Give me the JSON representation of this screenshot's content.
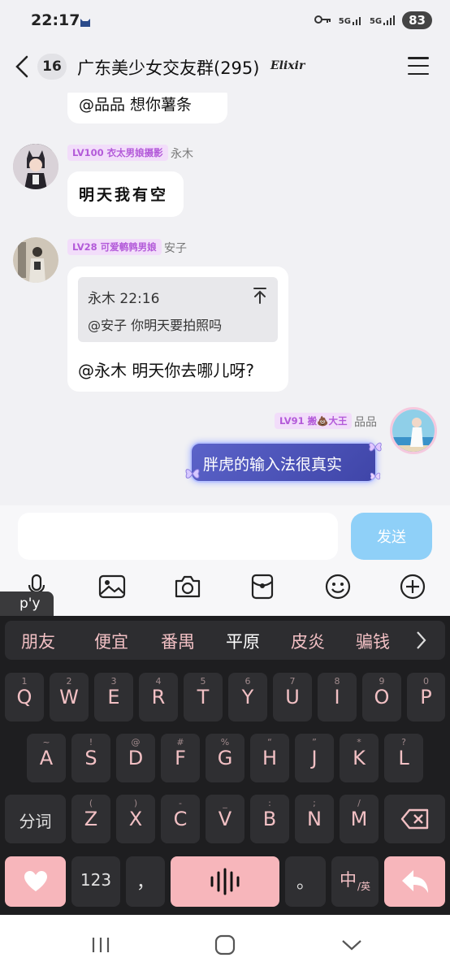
{
  "status_bar": {
    "time": "22:17",
    "network1": "5G",
    "network2": "5G",
    "battery": "83"
  },
  "header": {
    "unread_count": "16",
    "title": "广东美少女交友群(295)",
    "tag": "Elixir"
  },
  "messages": [
    {
      "id": "m0",
      "text": "@品品 想你薯条"
    },
    {
      "id": "m1",
      "level": "LV100 衣太男娘摄影",
      "nickname": "永木",
      "text": "明天我有空"
    },
    {
      "id": "m2",
      "level": "LV28 可爱鹌鹑男娘",
      "nickname": "安子",
      "quote": {
        "author_time": "永木 22:16",
        "text": "@安子 你明天要拍照吗"
      },
      "text": "@永木 明天你去哪儿呀?"
    },
    {
      "id": "m3",
      "level": "LV91 搬💩大王",
      "nickname": "品品",
      "text": "胖虎的输入法很真实"
    }
  ],
  "composer": {
    "input_value": "",
    "send_label": "发送",
    "pinyin": "p'y"
  },
  "candidates": [
    "朋友",
    "便宜",
    "番禺",
    "平原",
    "皮炎",
    "骗钱"
  ],
  "keyboard": {
    "row1": [
      {
        "sub": "1",
        "main": "Q"
      },
      {
        "sub": "2",
        "main": "W"
      },
      {
        "sub": "3",
        "main": "E"
      },
      {
        "sub": "4",
        "main": "R"
      },
      {
        "sub": "5",
        "main": "T"
      },
      {
        "sub": "6",
        "main": "Y"
      },
      {
        "sub": "7",
        "main": "U"
      },
      {
        "sub": "8",
        "main": "I"
      },
      {
        "sub": "9",
        "main": "O"
      },
      {
        "sub": "0",
        "main": "P"
      }
    ],
    "row2": [
      {
        "sub": "~",
        "main": "A"
      },
      {
        "sub": "!",
        "main": "S"
      },
      {
        "sub": "@",
        "main": "D"
      },
      {
        "sub": "#",
        "main": "F"
      },
      {
        "sub": "%",
        "main": "G"
      },
      {
        "sub": "“",
        "main": "H"
      },
      {
        "sub": "”",
        "main": "J"
      },
      {
        "sub": "*",
        "main": "K"
      },
      {
        "sub": "?",
        "main": "L"
      }
    ],
    "row3": [
      {
        "sub": "(",
        "main": "Z"
      },
      {
        "sub": ")",
        "main": "X"
      },
      {
        "sub": "-",
        "main": "C"
      },
      {
        "sub": "_",
        "main": "V"
      },
      {
        "sub": ":",
        "main": "B"
      },
      {
        "sub": ";",
        "main": "N"
      },
      {
        "sub": "/",
        "main": "M"
      }
    ],
    "fenci_label": "分词",
    "num_label": "123",
    "comma_label": "，",
    "period_label": "。",
    "lang_label": "中",
    "lang_sub": "/英"
  },
  "colors": {
    "send": "#8fd0f8",
    "key_text": "#f2c0c4",
    "accent_pink": "#f7b6bb",
    "badge_text": "#b35ad9"
  }
}
